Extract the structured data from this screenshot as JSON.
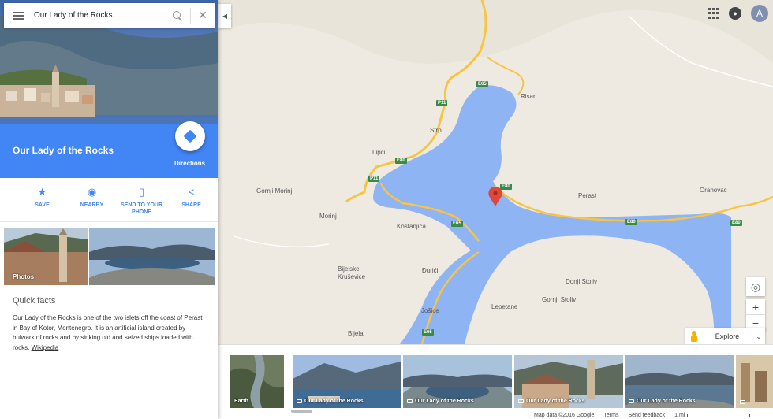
{
  "search": {
    "value": "Our Lady of the Rocks"
  },
  "place": {
    "title": "Our Lady of the Rocks",
    "directions_label": "Directions"
  },
  "actions": [
    {
      "label": "SAVE",
      "icon": "star-icon"
    },
    {
      "label": "NEARBY",
      "icon": "nearby-icon"
    },
    {
      "label": "SEND TO YOUR PHONE",
      "icon": "send-to-phone-icon"
    },
    {
      "label": "SHARE",
      "icon": "share-icon"
    }
  ],
  "panel_photos": {
    "photos_label": "Photos"
  },
  "quick_facts": {
    "title": "Quick facts",
    "text": "Our Lady of the Rocks is one of the two islets off the coast of Perast in Bay of Kotor, Montenegro. It is an artificial island created by bulwark of rocks and by sinking old and seized ships loaded with rocks.",
    "link": "Wikipedia"
  },
  "map": {
    "places": [
      "Risan",
      "Strp",
      "Lipci",
      "Gornji Morinj",
      "Morinj",
      "Perast",
      "Orahovac",
      "Kostanjica",
      "Bijelske Kruševice",
      "Đurići",
      "Donji Stoliv",
      "Gornji Stoliv",
      "Lepetane",
      "Jošice",
      "Bijela"
    ],
    "roads": [
      "E65",
      "P11",
      "E80",
      "E80",
      "P11",
      "E80",
      "E65",
      "E80",
      "E65"
    ],
    "explore_label": "Explore",
    "user_initial": "A"
  },
  "strip": {
    "earth_label": "Earth",
    "thumb_label": "Our Lady of the Rocks"
  },
  "footer": {
    "map_data": "Map data ©2016 Google",
    "terms": "Terms",
    "feedback": "Send feedback",
    "scale": "1 mi"
  },
  "colors": {
    "accent": "#4285f4",
    "water": "#8fb4f4",
    "land": "#eeeae2",
    "road_major": "#f6c545",
    "pin": "#e2463a"
  }
}
